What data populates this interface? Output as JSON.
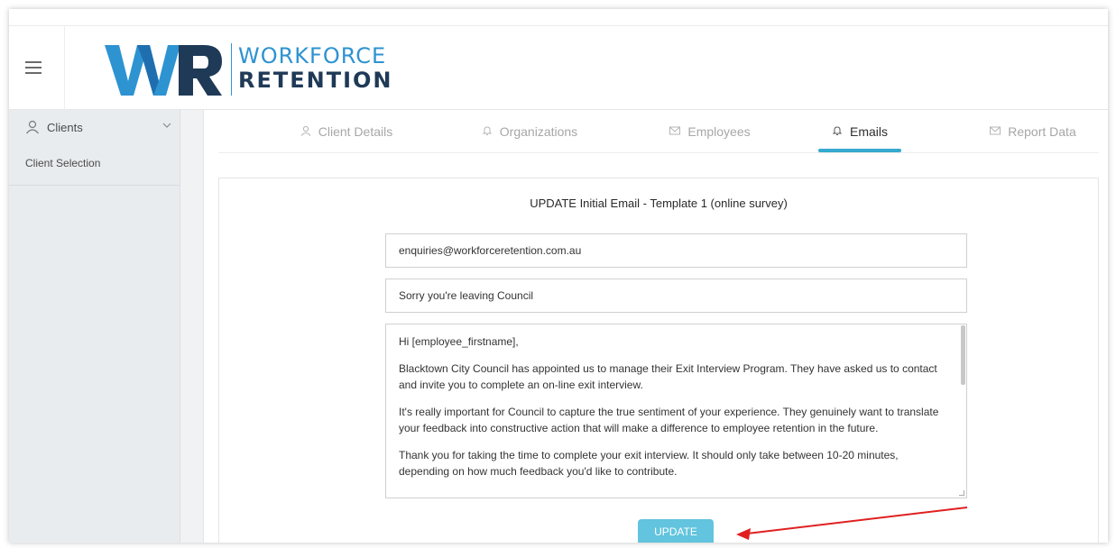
{
  "brand": {
    "logo_mark": "WR",
    "name_line1": "WORKFORCE",
    "name_line2": "RETENTION",
    "colors": {
      "blue": "#2e93d1",
      "navy": "#1f3a57",
      "accent": "#35a9cf",
      "button": "#62c4de"
    }
  },
  "header": {
    "menu_icon": "hamburger-icon"
  },
  "sidebar": {
    "menu": {
      "label": "Clients",
      "icon": "user-icon",
      "chevron": "chevron-down-icon"
    },
    "items": [
      {
        "label": "Client Selection"
      }
    ]
  },
  "tabs": [
    {
      "label": "Client Details",
      "icon": "user-icon",
      "active": false
    },
    {
      "label": "Organizations",
      "icon": "bell-icon",
      "active": false
    },
    {
      "label": "Employees",
      "icon": "mail-icon",
      "active": false
    },
    {
      "label": "Emails",
      "icon": "bell-icon",
      "active": true
    },
    {
      "label": "Report Data",
      "icon": "mail-icon",
      "active": false
    }
  ],
  "form": {
    "title": "UPDATE Initial Email - Template 1 (online survey)",
    "from_value": "enquiries@workforceretention.com.au",
    "subject_value": "Sorry you're leaving Council",
    "body_paragraphs": [
      "Hi [employee_firstname],",
      "Blacktown City Council has appointed us to manage their Exit Interview Program. They have asked us to contact and invite you to complete an on-line exit interview.",
      "It's really important for Council to capture the true sentiment of your experience. They genuinely want to translate your feedback into constructive action that will make a difference to employee retention in the future.",
      "Thank you for taking the time to complete your exit interview. It should only take between 10-20 minutes, depending on how much feedback you'd like to contribute."
    ],
    "update_label": "UPDATE"
  },
  "annotation": {
    "arrow_color": "#e02020"
  }
}
